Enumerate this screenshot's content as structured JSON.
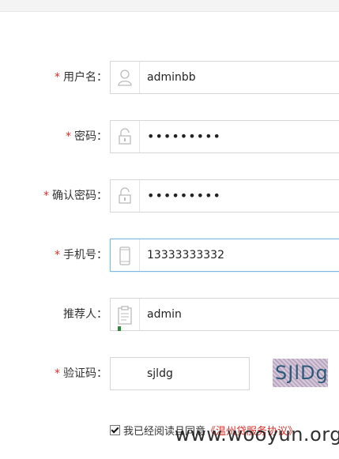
{
  "form": {
    "username": {
      "label": "用户名：",
      "value": "adminbb",
      "required": true
    },
    "password": {
      "label": "密码：",
      "value": "•••••••••",
      "required": true
    },
    "confirm_password": {
      "label": "确认密码：",
      "value": "•••••••••",
      "required": true
    },
    "phone": {
      "label": "手机号：",
      "value": "13333333332",
      "required": true
    },
    "referrer": {
      "label": "推荐人：",
      "value": "admin",
      "required": false
    },
    "captcha": {
      "label": "验证码：",
      "value": "sjldg",
      "image_text": "SJlDg",
      "required": true
    },
    "required_mark": "*"
  },
  "agreement": {
    "checked": true,
    "text": "我已经阅读且同意",
    "link": "《温州贷服务协议》"
  },
  "watermark": "www.wooyun.org",
  "colors": {
    "required": "#d9302b",
    "focus_border": "#7fb7e6"
  }
}
